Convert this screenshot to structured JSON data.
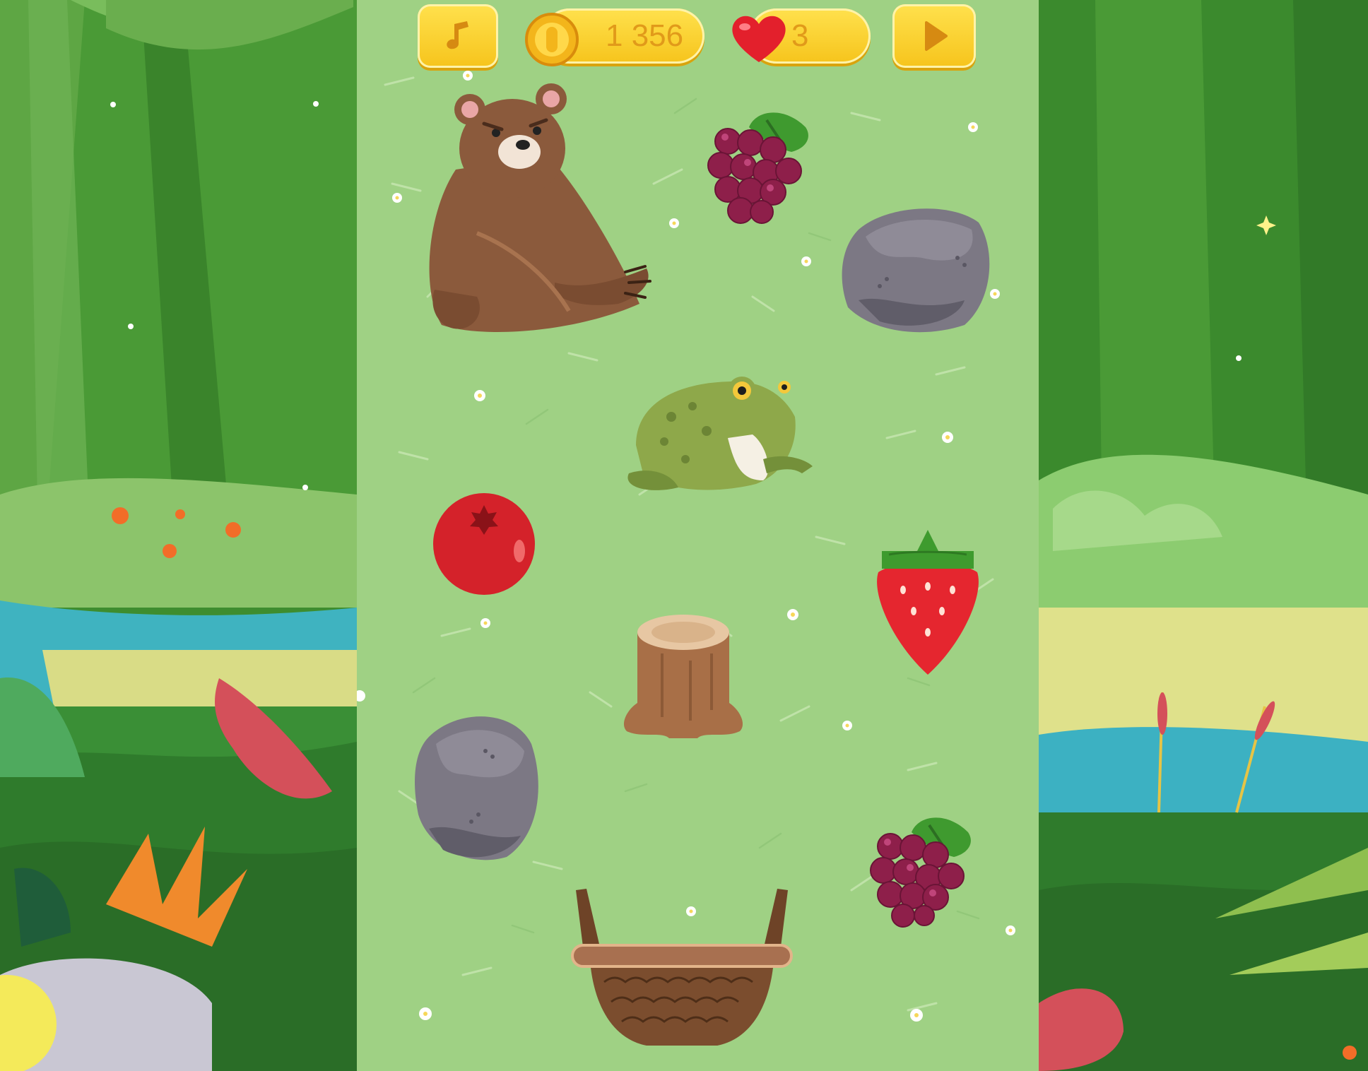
{
  "hud": {
    "coins": "1 356",
    "lives": "3",
    "music_icon": "music-note-icon",
    "coin_icon": "gold-coin-icon",
    "heart_icon": "heart-icon",
    "play_icon": "play-icon"
  },
  "board_items": [
    "bear",
    "grapes",
    "rock",
    "frog",
    "cranberry",
    "strawberry",
    "tree-stump",
    "rock",
    "grapes",
    "basket"
  ],
  "colors": {
    "hud_yellow": "#f8c91f",
    "hud_text": "#e19a1a",
    "grass": "#9fd184",
    "forest_dark": "#2f7a2a"
  }
}
